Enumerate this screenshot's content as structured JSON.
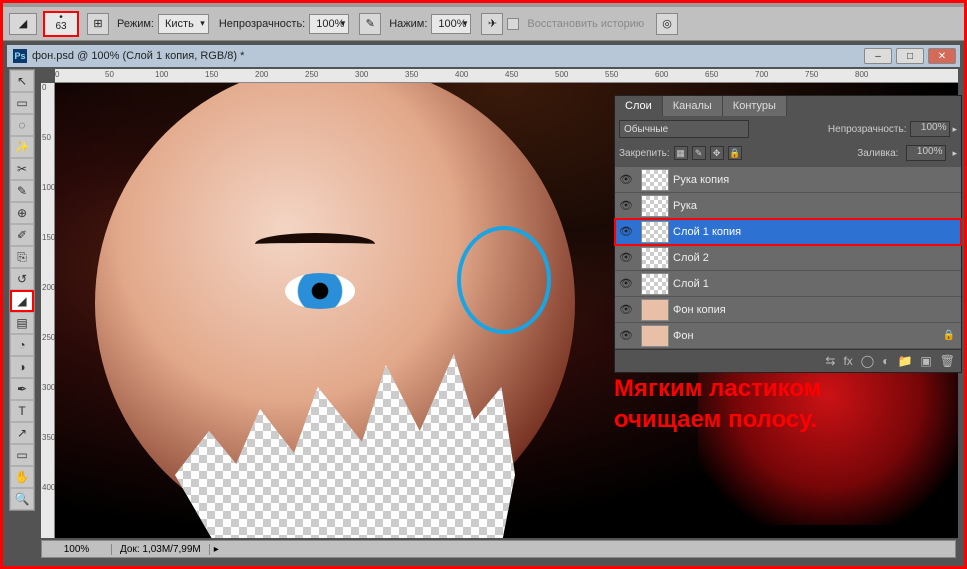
{
  "options": {
    "brush_size": "63",
    "mode_label": "Режим:",
    "mode_value": "Кисть",
    "opacity_label": "Непрозрачность:",
    "opacity_value": "100%",
    "flow_label": "Нажим:",
    "flow_value": "100%",
    "restore_label": "Восстановить историю"
  },
  "document": {
    "title": "фон.psd @ 100% (Слой 1 копия, RGB/8) *"
  },
  "ruler": {
    "h": [
      "0",
      "50",
      "100",
      "150",
      "200",
      "250",
      "300",
      "350",
      "400",
      "450",
      "500",
      "550",
      "600",
      "650",
      "700",
      "750",
      "800"
    ],
    "v": [
      "0",
      "50",
      "100",
      "150",
      "200",
      "250",
      "300",
      "350",
      "400"
    ]
  },
  "status": {
    "zoom": "100%",
    "doc": "Док: 1,03M/7,99M"
  },
  "layers_panel": {
    "tabs": [
      "Слои",
      "Каналы",
      "Контуры"
    ],
    "blend_mode": "Обычные",
    "opacity_label": "Непрозрачность:",
    "opacity_value": "100%",
    "lock_label": "Закрепить:",
    "fill_label": "Заливка:",
    "fill_value": "100%",
    "layers": [
      {
        "name": "Рука копия",
        "selected": false
      },
      {
        "name": "Рука",
        "selected": false
      },
      {
        "name": "Слой 1 копия",
        "selected": true
      },
      {
        "name": "Слой 2",
        "selected": false
      },
      {
        "name": "Слой 1",
        "selected": false
      },
      {
        "name": "Фон копия",
        "selected": false
      },
      {
        "name": "Фон",
        "selected": false
      }
    ]
  },
  "annotation": {
    "line1": "Мягким ластиком",
    "line2": "очищаем полосу."
  },
  "toolbox": {
    "tools": [
      "↖",
      "▭",
      "◌",
      "✂",
      "✎",
      "⊕",
      "✐",
      "⎘",
      "▤",
      "◔",
      "◢",
      "✦",
      "T",
      "▿",
      "◑",
      "✋",
      "🔍"
    ]
  }
}
